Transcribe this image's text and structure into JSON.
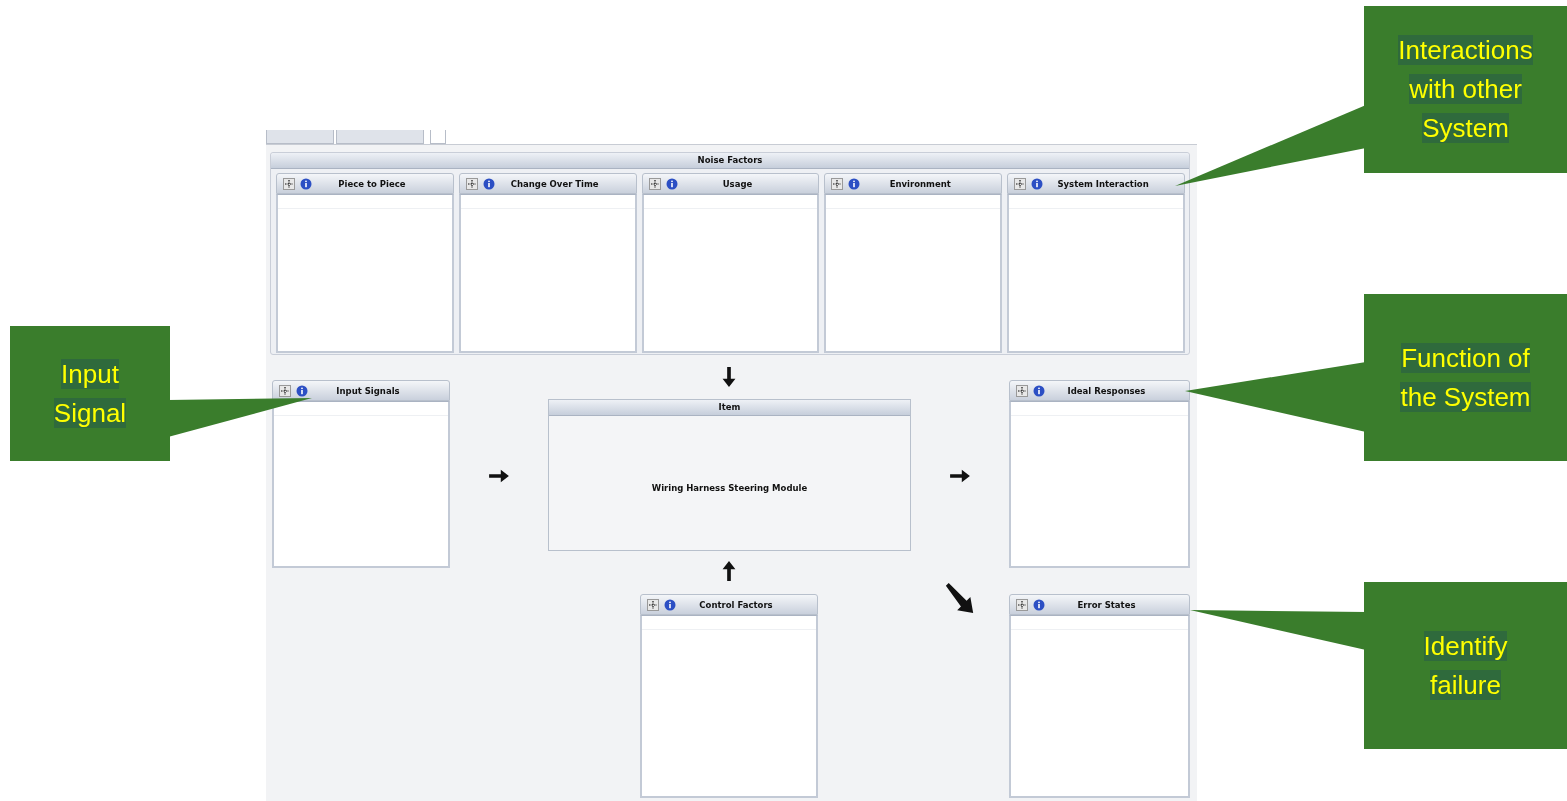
{
  "tabs": [
    {
      "selected": false
    },
    {
      "selected": false
    },
    {
      "selected": true
    }
  ],
  "noise_factors": {
    "title": "Noise Factors",
    "panels": [
      {
        "title": "Piece to Piece"
      },
      {
        "title": "Change Over Time"
      },
      {
        "title": "Usage"
      },
      {
        "title": "Environment"
      },
      {
        "title": "System Interaction"
      }
    ]
  },
  "input_signals": {
    "title": "Input Signals"
  },
  "item": {
    "title": "Item",
    "name": "Wiring Harness Steering Module"
  },
  "ideal_responses": {
    "title": "Ideal Responses"
  },
  "control_factors": {
    "title": "Control Factors"
  },
  "error_states": {
    "title": "Error States"
  },
  "callouts": [
    {
      "text": "Interactions with other System"
    },
    {
      "text": "Input Signal"
    },
    {
      "text": "Function of the System"
    },
    {
      "text": "Identify failure"
    }
  ]
}
